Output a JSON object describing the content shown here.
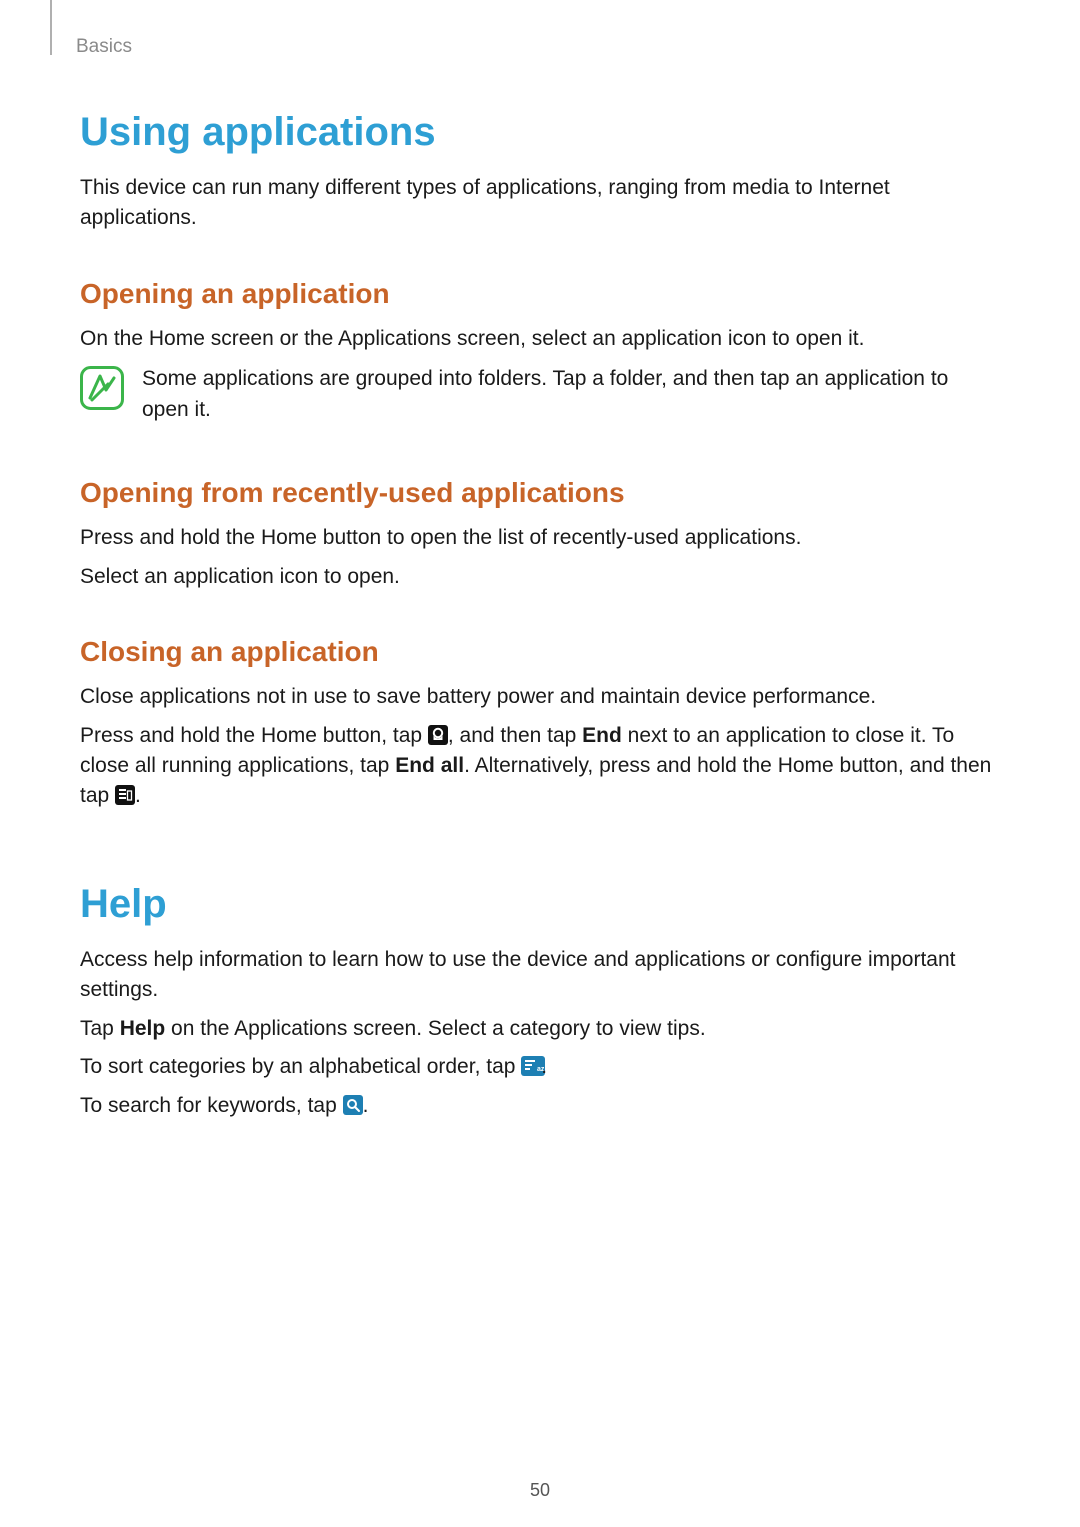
{
  "breadcrumb": "Basics",
  "page_number": "50",
  "section1": {
    "title": "Using applications",
    "intro": "This device can run many different types of applications, ranging from media to Internet applications.",
    "sub1": {
      "title": "Opening an application",
      "p1": "On the Home screen or the Applications screen, select an application icon to open it.",
      "note": "Some applications are grouped into folders. Tap a folder, and then tap an application to open it."
    },
    "sub2": {
      "title": "Opening from recently-used applications",
      "p1": "Press and hold the Home button to open the list of recently-used applications.",
      "p2": "Select an application icon to open."
    },
    "sub3": {
      "title": "Closing an application",
      "p1": "Close applications not in use to save battery power and maintain device performance.",
      "p2a": "Press and hold the Home button, tap ",
      "p2b": ", and then tap ",
      "p2_bold1": "End",
      "p2c": " next to an application to close it. To close all running applications, tap ",
      "p2_bold2": "End all",
      "p2d": ". Alternatively, press and hold the Home button, and then tap ",
      "p2e": "."
    }
  },
  "section2": {
    "title": "Help",
    "intro": "Access help information to learn how to use the device and applications or configure important settings.",
    "p2a": "Tap ",
    "p2_bold": "Help",
    "p2b": " on the Applications screen. Select a category to view tips.",
    "p3a": "To sort categories by an alphabetical order, tap ",
    "p3b": ".",
    "p4a": "To search for keywords, tap ",
    "p4b": "."
  }
}
